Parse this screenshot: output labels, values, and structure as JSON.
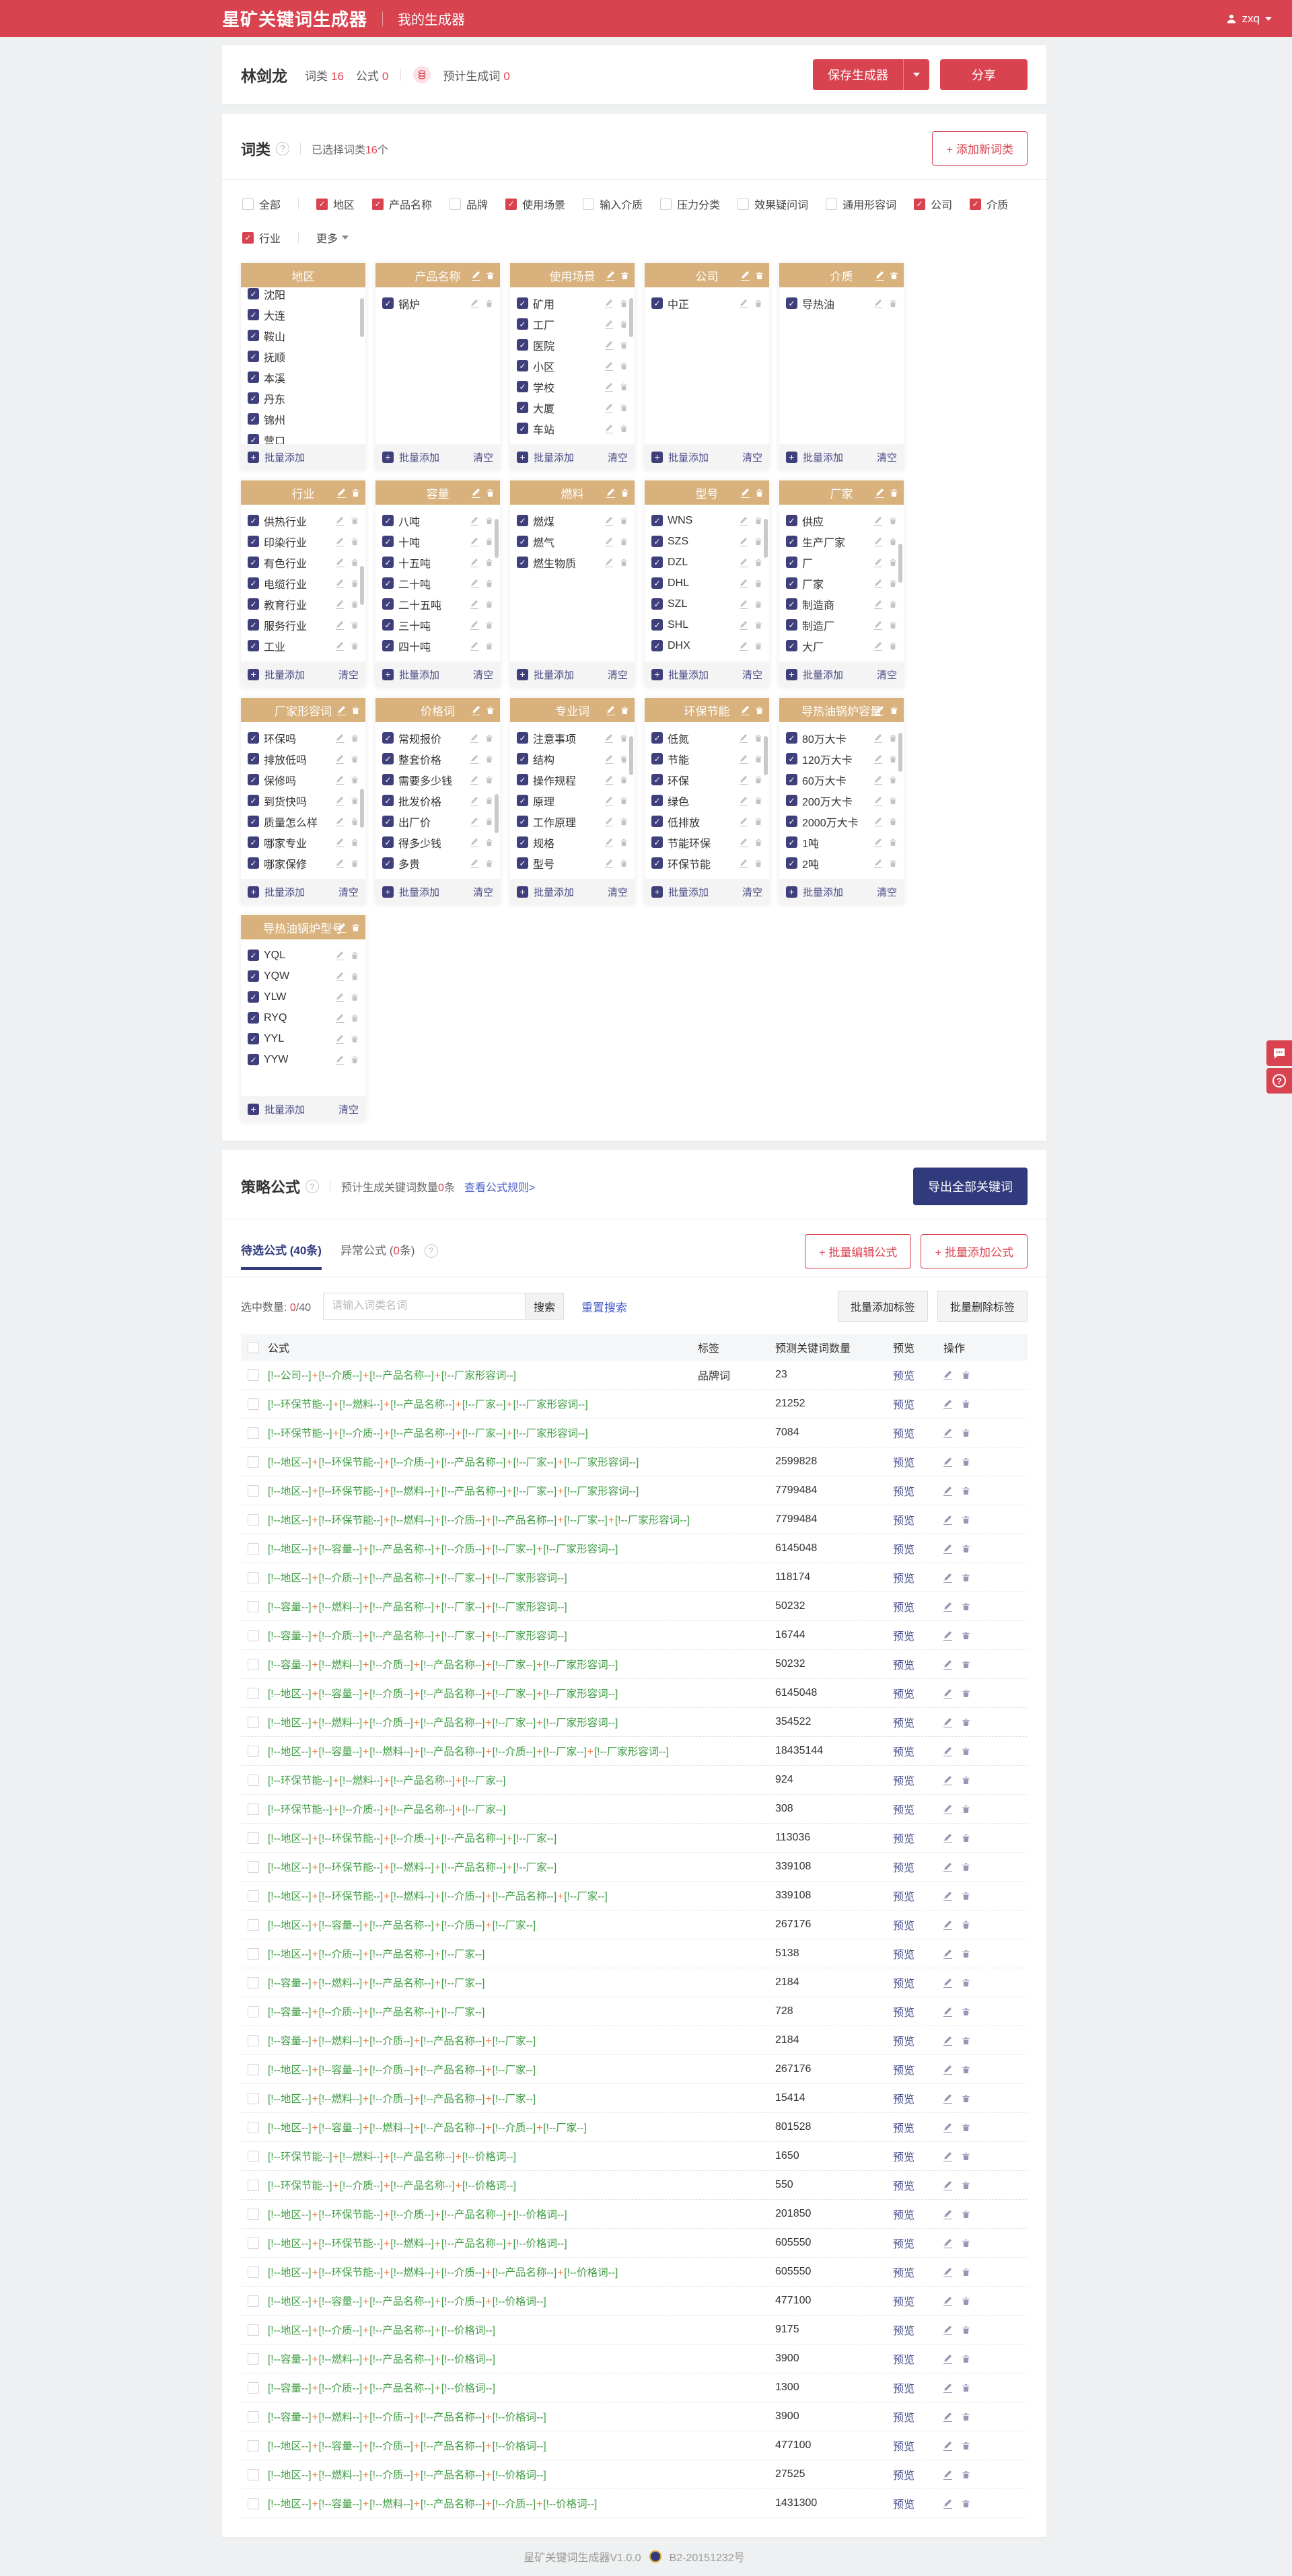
{
  "colors": {
    "brand_red": "#d9424f",
    "card_header_tan": "#d8b17c",
    "checkbox_navy": "#3f3f7c",
    "navy_button": "#303a7d",
    "formula_green": "#3f9d44",
    "plus_orange": "#f07a3a",
    "link_blue": "#4a5ec9"
  },
  "header": {
    "logo": "星矿关键词生成器",
    "nav": "我的生成器",
    "user": "zxq"
  },
  "generator": {
    "name": "林剑龙",
    "stats": [
      {
        "label": "词类",
        "value": "16"
      },
      {
        "label": "公式",
        "value": "0"
      }
    ],
    "estimate_label": "预计生成词",
    "estimate_value": "0",
    "save_button": "保存生成器",
    "share_button": "分享"
  },
  "word_section": {
    "title": "词类",
    "selected_prefix": "已选择词类",
    "selected_count": "16",
    "selected_suffix": "个",
    "add_button": "+ 添加新词类",
    "more_label": "更多",
    "batch_add_label": "批量添加",
    "clear_label": "清空",
    "filters": [
      {
        "label": "全部",
        "checked": false
      },
      {
        "label": "地区",
        "checked": true
      },
      {
        "label": "产品名称",
        "checked": true
      },
      {
        "label": "品牌",
        "checked": false
      },
      {
        "label": "使用场景",
        "checked": true
      },
      {
        "label": "输入介质",
        "checked": false
      },
      {
        "label": "压力分类",
        "checked": false
      },
      {
        "label": "效果疑问词",
        "checked": false
      },
      {
        "label": "通用形容词",
        "checked": false
      },
      {
        "label": "公司",
        "checked": true
      },
      {
        "label": "介质",
        "checked": true
      },
      {
        "label": "行业",
        "checked": true
      }
    ],
    "cards": [
      {
        "title": "地区",
        "header_icons": false,
        "item_icons": false,
        "clear": false,
        "scrollbar": true,
        "thumb": 0.05,
        "offset": -14,
        "items": [
          "沈阳",
          "大连",
          "鞍山",
          "抚顺",
          "本溪",
          "丹东",
          "锦州",
          "营口"
        ]
      },
      {
        "title": "产品名称",
        "header_icons": true,
        "item_icons": true,
        "clear": true,
        "scrollbar": false,
        "items": [
          "锅炉"
        ]
      },
      {
        "title": "使用场景",
        "header_icons": true,
        "item_icons": true,
        "clear": true,
        "scrollbar": true,
        "thumb": 0.05,
        "items": [
          "矿用",
          "工厂",
          "医院",
          "小区",
          "学校",
          "大厦",
          "车站"
        ]
      },
      {
        "title": "公司",
        "header_icons": true,
        "item_icons": true,
        "clear": true,
        "scrollbar": false,
        "items": [
          "中正"
        ]
      },
      {
        "title": "介质",
        "header_icons": true,
        "item_icons": true,
        "clear": true,
        "scrollbar": false,
        "items": [
          "导热油"
        ]
      },
      {
        "title": "行业",
        "header_icons": true,
        "item_icons": true,
        "clear": true,
        "scrollbar": true,
        "thumb": 0.5,
        "items": [
          "供热行业",
          "印染行业",
          "有色行业",
          "电缆行业",
          "教育行业",
          "服务行业",
          "工业"
        ]
      },
      {
        "title": "容量",
        "header_icons": true,
        "item_icons": true,
        "clear": true,
        "scrollbar": true,
        "thumb": 0.08,
        "items": [
          "八吨",
          "十吨",
          "十五吨",
          "二十吨",
          "二十五吨",
          "三十吨",
          "四十吨"
        ]
      },
      {
        "title": "燃料",
        "header_icons": true,
        "item_icons": true,
        "clear": true,
        "scrollbar": false,
        "items": [
          "燃煤",
          "燃气",
          "燃生物质"
        ]
      },
      {
        "title": "型号",
        "header_icons": true,
        "item_icons": true,
        "clear": true,
        "scrollbar": true,
        "thumb": 0.08,
        "items": [
          "WNS",
          "SZS",
          "DZL",
          "DHL",
          "SZL",
          "SHL",
          "DHX"
        ]
      },
      {
        "title": "厂家",
        "header_icons": true,
        "item_icons": true,
        "clear": true,
        "scrollbar": true,
        "thumb": 0.3,
        "items": [
          "供应",
          "生产厂家",
          "厂",
          "厂家",
          "制造商",
          "制造厂",
          "大厂"
        ]
      },
      {
        "title": "厂家形容词",
        "header_icons": true,
        "item_icons": true,
        "clear": true,
        "scrollbar": true,
        "thumb": 0.55,
        "items": [
          "环保吗",
          "排放低吗",
          "保修吗",
          "到货快吗",
          "质量怎么样",
          "哪家专业",
          "哪家保修"
        ]
      },
      {
        "title": "价格词",
        "header_icons": true,
        "item_icons": true,
        "clear": true,
        "scrollbar": true,
        "thumb": 0.6,
        "items": [
          "常规报价",
          "整套价格",
          "需要多少钱",
          "批发价格",
          "出厂价",
          "得多少钱",
          "多贵"
        ]
      },
      {
        "title": "专业词",
        "header_icons": true,
        "item_icons": true,
        "clear": true,
        "scrollbar": true,
        "thumb": 0.08,
        "items": [
          "注意事项",
          "结构",
          "操作规程",
          "原理",
          "工作原理",
          "规格",
          "型号"
        ]
      },
      {
        "title": "环保节能",
        "header_icons": true,
        "item_icons": true,
        "clear": true,
        "scrollbar": true,
        "thumb": 0.08,
        "items": [
          "低氮",
          "节能",
          "环保",
          "绿色",
          "低排放",
          "节能环保",
          "环保节能"
        ]
      },
      {
        "title": "导热油锅炉容量",
        "header_icons": true,
        "item_icons": true,
        "clear": true,
        "scrollbar": true,
        "thumb": 0.05,
        "items": [
          "80万大卡",
          "120万大卡",
          "60万大卡",
          "200万大卡",
          "2000万大卡",
          "1吨",
          "2吨"
        ]
      },
      {
        "title": "导热油锅炉型号",
        "header_icons": true,
        "item_icons": true,
        "clear": true,
        "scrollbar": false,
        "items": [
          "YQL",
          "YQW",
          "YLW",
          "RYQ",
          "YYL",
          "YYW"
        ]
      }
    ]
  },
  "formula_section": {
    "title": "策略公式",
    "subtitle_prefix": "预计生成关键词数量",
    "subtitle_count": "0",
    "subtitle_suffix": "条",
    "rule_link": "查看公式规则>",
    "export_button": "导出全部关键词",
    "tab_active": "待选公式 (40条)",
    "tab2_prefix": "异常公式 (",
    "tab2_count": "0",
    "tab2_suffix": "条)",
    "batch_edit_button": "+ 批量编辑公式",
    "batch_add_button": "+ 批量添加公式",
    "selected_label": "选中数量:",
    "selected_value": "0",
    "selected_total": "/40",
    "search_placeholder": "请输入词类名词",
    "search_button": "搜索",
    "reset_button": "重置搜索",
    "tag_add_button": "批量添加标签",
    "tag_delete_button": "批量删除标签",
    "columns": {
      "formula": "公式",
      "tag": "标签",
      "count": "预测关键词数量",
      "preview": "预览",
      "action": "操作"
    },
    "preview_label": "预览",
    "formulas": [
      {
        "parts": [
          "公司",
          "介质",
          "产品名称",
          "厂家形容词"
        ],
        "tag": "品牌词",
        "count": "23"
      },
      {
        "parts": [
          "环保节能",
          "燃料",
          "产品名称",
          "厂家",
          "厂家形容词"
        ],
        "tag": "",
        "count": "21252"
      },
      {
        "parts": [
          "环保节能",
          "介质",
          "产品名称",
          "厂家",
          "厂家形容词"
        ],
        "tag": "",
        "count": "7084"
      },
      {
        "parts": [
          "地区",
          "环保节能",
          "介质",
          "产品名称",
          "厂家",
          "厂家形容词"
        ],
        "tag": "",
        "count": "2599828"
      },
      {
        "parts": [
          "地区",
          "环保节能",
          "燃料",
          "产品名称",
          "厂家",
          "厂家形容词"
        ],
        "tag": "",
        "count": "7799484"
      },
      {
        "parts": [
          "地区",
          "环保节能",
          "燃料",
          "介质",
          "产品名称",
          "厂家",
          "厂家形容词"
        ],
        "tag": "",
        "count": "7799484"
      },
      {
        "parts": [
          "地区",
          "容量",
          "产品名称",
          "介质",
          "厂家",
          "厂家形容词"
        ],
        "tag": "",
        "count": "6145048"
      },
      {
        "parts": [
          "地区",
          "介质",
          "产品名称",
          "厂家",
          "厂家形容词"
        ],
        "tag": "",
        "count": "118174"
      },
      {
        "parts": [
          "容量",
          "燃料",
          "产品名称",
          "厂家",
          "厂家形容词"
        ],
        "tag": "",
        "count": "50232"
      },
      {
        "parts": [
          "容量",
          "介质",
          "产品名称",
          "厂家",
          "厂家形容词"
        ],
        "tag": "",
        "count": "16744"
      },
      {
        "parts": [
          "容量",
          "燃料",
          "介质",
          "产品名称",
          "厂家",
          "厂家形容词"
        ],
        "tag": "",
        "count": "50232"
      },
      {
        "parts": [
          "地区",
          "容量",
          "介质",
          "产品名称",
          "厂家",
          "厂家形容词"
        ],
        "tag": "",
        "count": "6145048"
      },
      {
        "parts": [
          "地区",
          "燃料",
          "介质",
          "产品名称",
          "厂家",
          "厂家形容词"
        ],
        "tag": "",
        "count": "354522"
      },
      {
        "parts": [
          "地区",
          "容量",
          "燃料",
          "产品名称",
          "介质",
          "厂家",
          "厂家形容词"
        ],
        "tag": "",
        "count": "18435144"
      },
      {
        "parts": [
          "环保节能",
          "燃料",
          "产品名称",
          "厂家"
        ],
        "tag": "",
        "count": "924"
      },
      {
        "parts": [
          "环保节能",
          "介质",
          "产品名称",
          "厂家"
        ],
        "tag": "",
        "count": "308"
      },
      {
        "parts": [
          "地区",
          "环保节能",
          "介质",
          "产品名称",
          "厂家"
        ],
        "tag": "",
        "count": "113036"
      },
      {
        "parts": [
          "地区",
          "环保节能",
          "燃料",
          "产品名称",
          "厂家"
        ],
        "tag": "",
        "count": "339108"
      },
      {
        "parts": [
          "地区",
          "环保节能",
          "燃料",
          "介质",
          "产品名称",
          "厂家"
        ],
        "tag": "",
        "count": "339108"
      },
      {
        "parts": [
          "地区",
          "容量",
          "产品名称",
          "介质",
          "厂家"
        ],
        "tag": "",
        "count": "267176"
      },
      {
        "parts": [
          "地区",
          "介质",
          "产品名称",
          "厂家"
        ],
        "tag": "",
        "count": "5138"
      },
      {
        "parts": [
          "容量",
          "燃料",
          "产品名称",
          "厂家"
        ],
        "tag": "",
        "count": "2184"
      },
      {
        "parts": [
          "容量",
          "介质",
          "产品名称",
          "厂家"
        ],
        "tag": "",
        "count": "728"
      },
      {
        "parts": [
          "容量",
          "燃料",
          "介质",
          "产品名称",
          "厂家"
        ],
        "tag": "",
        "count": "2184"
      },
      {
        "parts": [
          "地区",
          "容量",
          "介质",
          "产品名称",
          "厂家"
        ],
        "tag": "",
        "count": "267176"
      },
      {
        "parts": [
          "地区",
          "燃料",
          "介质",
          "产品名称",
          "厂家"
        ],
        "tag": "",
        "count": "15414"
      },
      {
        "parts": [
          "地区",
          "容量",
          "燃料",
          "产品名称",
          "介质",
          "厂家"
        ],
        "tag": "",
        "count": "801528"
      },
      {
        "parts": [
          "环保节能",
          "燃料",
          "产品名称",
          "价格词"
        ],
        "tag": "",
        "count": "1650"
      },
      {
        "parts": [
          "环保节能",
          "介质",
          "产品名称",
          "价格词"
        ],
        "tag": "",
        "count": "550"
      },
      {
        "parts": [
          "地区",
          "环保节能",
          "介质",
          "产品名称",
          "价格词"
        ],
        "tag": "",
        "count": "201850"
      },
      {
        "parts": [
          "地区",
          "环保节能",
          "燃料",
          "产品名称",
          "价格词"
        ],
        "tag": "",
        "count": "605550"
      },
      {
        "parts": [
          "地区",
          "环保节能",
          "燃料",
          "介质",
          "产品名称",
          "价格词"
        ],
        "tag": "",
        "count": "605550"
      },
      {
        "parts": [
          "地区",
          "容量",
          "产品名称",
          "介质",
          "价格词"
        ],
        "tag": "",
        "count": "477100"
      },
      {
        "parts": [
          "地区",
          "介质",
          "产品名称",
          "价格词"
        ],
        "tag": "",
        "count": "9175"
      },
      {
        "parts": [
          "容量",
          "燃料",
          "产品名称",
          "价格词"
        ],
        "tag": "",
        "count": "3900"
      },
      {
        "parts": [
          "容量",
          "介质",
          "产品名称",
          "价格词"
        ],
        "tag": "",
        "count": "1300"
      },
      {
        "parts": [
          "容量",
          "燃料",
          "介质",
          "产品名称",
          "价格词"
        ],
        "tag": "",
        "count": "3900"
      },
      {
        "parts": [
          "地区",
          "容量",
          "介质",
          "产品名称",
          "价格词"
        ],
        "tag": "",
        "count": "477100"
      },
      {
        "parts": [
          "地区",
          "燃料",
          "介质",
          "产品名称",
          "价格词"
        ],
        "tag": "",
        "count": "27525"
      },
      {
        "parts": [
          "地区",
          "容量",
          "燃料",
          "产品名称",
          "介质",
          "价格词"
        ],
        "tag": "",
        "count": "1431300"
      }
    ]
  },
  "footer": {
    "version": "星矿关键词生成器V1.0.0",
    "icp": "B2-20151232号"
  }
}
